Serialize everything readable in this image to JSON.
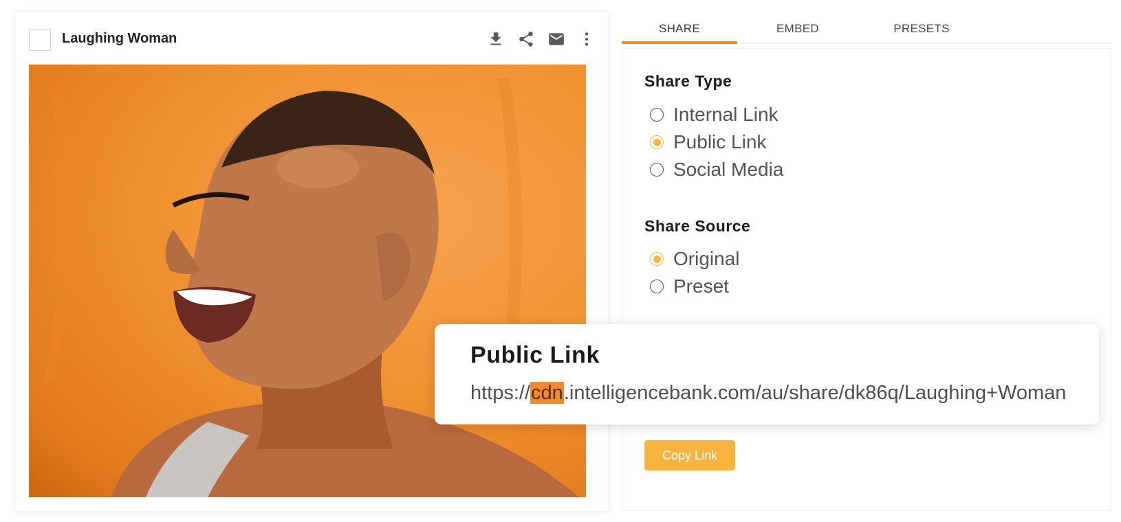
{
  "asset": {
    "title": "Laughing Woman",
    "actions": [
      "download-icon",
      "share-icon",
      "email-icon",
      "more-vertical-icon"
    ]
  },
  "tabs": [
    {
      "label": "SHARE",
      "active": true
    },
    {
      "label": "EMBED",
      "active": false
    },
    {
      "label": "PRESETS",
      "active": false
    }
  ],
  "share_type": {
    "title": "Share Type",
    "options": [
      {
        "label": "Internal Link",
        "checked": false
      },
      {
        "label": "Public Link",
        "checked": true
      },
      {
        "label": "Social Media",
        "checked": false
      }
    ]
  },
  "share_source": {
    "title": "Share Source",
    "options": [
      {
        "label": "Original",
        "checked": true
      },
      {
        "label": "Preset",
        "checked": false
      }
    ]
  },
  "public_link": {
    "title": "Public Link",
    "url_prefix": "https://",
    "url_highlight": "cdn",
    "url_suffix": ".intelligencebank.com/au/share/dk86q/Laughing+Woman"
  },
  "copy_button": {
    "label": "Copy Link"
  },
  "colors": {
    "accent_orange": "#f28a2b",
    "radio_selected": "#f5b743",
    "button_bg": "#f7b43e"
  }
}
